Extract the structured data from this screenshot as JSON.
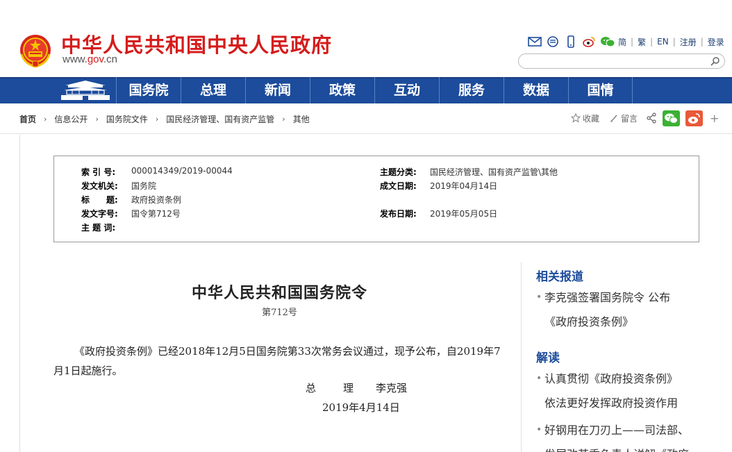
{
  "header": {
    "site_title": "中华人民共和国中央人民政府",
    "site_url_prefix": "www.",
    "site_url_brand": "gov",
    "site_url_suffix": ".cn",
    "emblem_icon": "national-emblem-icon"
  },
  "toolbar": {
    "icons": [
      "mail-icon",
      "chat-icon",
      "mobile-icon",
      "weibo-icon",
      "wechat-icon"
    ],
    "links": [
      "简",
      "繁",
      "EN",
      "注册",
      "登录"
    ],
    "separator": "|"
  },
  "search": {
    "placeholder": "",
    "value": "",
    "icon": "search-icon"
  },
  "nav": {
    "home_icon": "tiananmen-icon",
    "items": [
      "国务院",
      "总理",
      "新闻",
      "政策",
      "互动",
      "服务",
      "数据",
      "国情"
    ],
    "bg_color": "#1c4c9b"
  },
  "breadcrumb": {
    "items": [
      "首页",
      "信息公开",
      "国务院文件",
      "国民经济管理、国有资产监管",
      "其他"
    ],
    "separator": "›"
  },
  "share": {
    "favorite": "收藏",
    "message": "留言",
    "wechat_color": "#3cb034",
    "weibo_color": "#e8593a",
    "plus": "+"
  },
  "meta": {
    "index_label": "索 引 号:",
    "index_value": "000014349/2019-00044",
    "topic_class_label": "主题分类:",
    "topic_class_value": "国民经济管理、国有资产监管\\其他",
    "issuer_label": "发文机关:",
    "issuer_value": "国务院",
    "date_written_label": "成文日期:",
    "date_written_value": "2019年04月14日",
    "title_label": "标　　题:",
    "title_value": "政府投资条例",
    "doc_no_label": "发文字号:",
    "doc_no_value": "国令第712号",
    "publish_label": "发布日期:",
    "publish_value": "2019年05月05日",
    "keywords_label": "主 题 词:",
    "keywords_value": ""
  },
  "article": {
    "title": "中华人民共和国国务院令",
    "number": "第712号",
    "body": "《政府投资条例》已经2018年12月5日国务院第33次常务会议通过，现予公布，自2019年7月1日起施行。",
    "sign_role": "总　理",
    "sign_name": "李克强",
    "date": "2019年4月14日"
  },
  "sidebar": {
    "related_title": "相关报道",
    "related_items": [
      {
        "line1": "李克强签署国务院令 公布",
        "line2": "《政府投资条例》"
      }
    ],
    "interpret_title": "解读",
    "interpret_items": [
      {
        "line1": "认真贯彻《政府投资条例》",
        "line2": "依法更好发挥政府投资作用"
      },
      {
        "line1": "好钢用在刀刃上——司法部、",
        "line2": "发展改革委负责人详解《政府"
      }
    ],
    "bullet": "•",
    "title_color": "#1c4c9b"
  }
}
